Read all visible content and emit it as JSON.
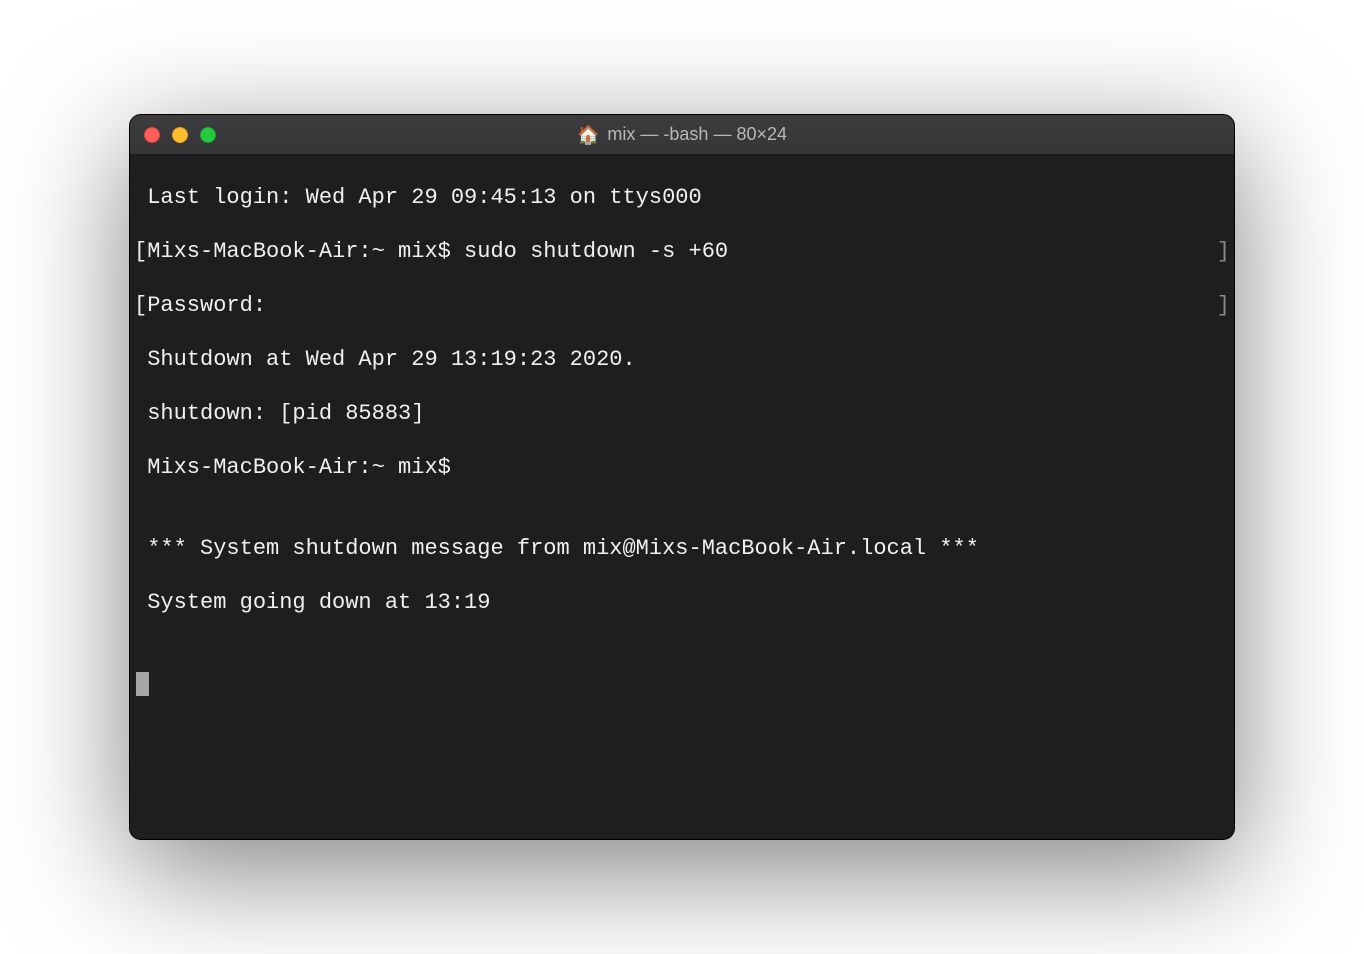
{
  "window": {
    "title_icon": "🏠",
    "title_text": "mix — -bash — 80×24"
  },
  "terminal": {
    "lines": [
      " Last login: Wed Apr 29 09:45:13 on ttys000",
      "[Mixs-MacBook-Air:~ mix$ sudo shutdown -s +60",
      "[Password:",
      " Shutdown at Wed Apr 29 13:19:23 2020.",
      " shutdown: [pid 85883]",
      " Mixs-MacBook-Air:~ mix$ ",
      "",
      " *** System shutdown message from mix@Mixs-MacBook-Air.local ***",
      " System going down at 13:19",
      "",
      ""
    ]
  }
}
